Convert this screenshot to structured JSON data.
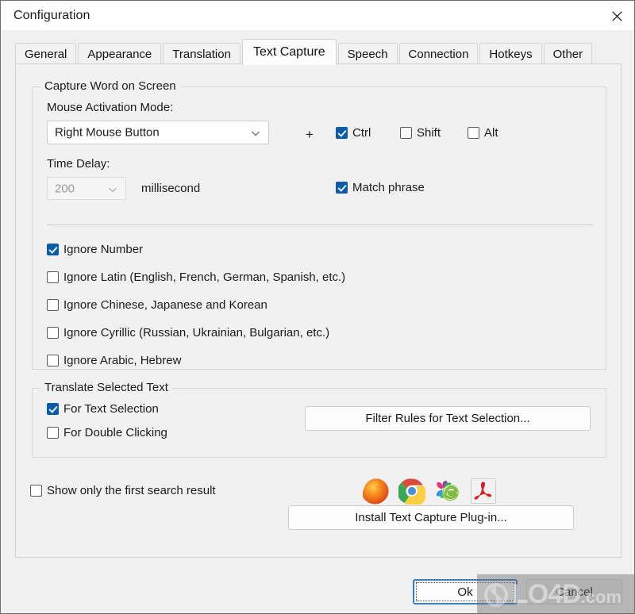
{
  "window": {
    "title": "Configuration",
    "close_icon": "close-icon"
  },
  "tabs": [
    {
      "label": "General",
      "active": false
    },
    {
      "label": "Appearance",
      "active": false
    },
    {
      "label": "Translation",
      "active": false
    },
    {
      "label": "Text Capture",
      "active": true
    },
    {
      "label": "Speech",
      "active": false
    },
    {
      "label": "Connection",
      "active": false
    },
    {
      "label": "Hotkeys",
      "active": false
    },
    {
      "label": "Other",
      "active": false
    }
  ],
  "capture_group": {
    "title": "Capture Word on Screen",
    "mouse_mode_label": "Mouse Activation Mode:",
    "mouse_mode_value": "Right Mouse Button",
    "plus_sign": "+",
    "modifiers": [
      {
        "label": "Ctrl",
        "checked": true
      },
      {
        "label": "Shift",
        "checked": false
      },
      {
        "label": "Alt",
        "checked": false
      }
    ],
    "time_delay_label": "Time Delay:",
    "time_delay_value": "200",
    "time_delay_unit": "millisecond",
    "match_phrase": {
      "label": "Match phrase",
      "checked": true
    },
    "ignore_options": [
      {
        "label": "Ignore Number",
        "checked": true
      },
      {
        "label": "Ignore Latin (English, French, German, Spanish, etc.)",
        "checked": false
      },
      {
        "label": "Ignore Chinese, Japanese and Korean",
        "checked": false
      },
      {
        "label": "Ignore Cyrillic (Russian, Ukrainian, Bulgarian, etc.)",
        "checked": false
      },
      {
        "label": "Ignore Arabic, Hebrew",
        "checked": false
      }
    ]
  },
  "translate_group": {
    "title": "Translate Selected Text",
    "for_text_selection": {
      "label": "For Text Selection",
      "checked": true
    },
    "for_double_clicking": {
      "label": "For Double Clicking",
      "checked": false
    },
    "filter_rules_button": "Filter Rules for Text Selection..."
  },
  "footer": {
    "show_first_result": {
      "label": "Show only the first search result",
      "checked": false
    },
    "install_plugin_button": "Install Text Capture Plug-in...",
    "browser_icons": [
      {
        "name": "firefox-icon",
        "title": "Firefox"
      },
      {
        "name": "chrome-icon",
        "title": "Chrome"
      },
      {
        "name": "ie-360-browser-icon",
        "title": "Internet Explorer / 360 Browser"
      },
      {
        "name": "adobe-acrobat-icon",
        "title": "Adobe Acrobat"
      }
    ]
  },
  "dialog_buttons": {
    "ok": "Ok",
    "cancel": "Cancel"
  },
  "watermark": {
    "text_main": "LO4D",
    "text_domain": ".com"
  },
  "colors": {
    "accent_checkbox": "#0a5ca8",
    "default_button_border": "#3d7ebd",
    "dialog_bg": "#f0f0f0",
    "page_bg": "#f1f1f1"
  }
}
